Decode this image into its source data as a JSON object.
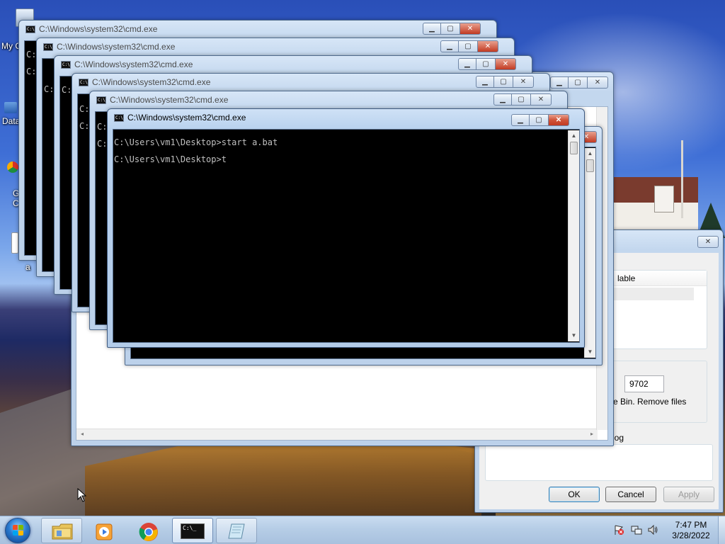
{
  "desktop": {
    "icons": [
      {
        "label": "My C"
      },
      {
        "label": "Data"
      },
      {
        "label": "G\nC"
      },
      {
        "label": "a"
      }
    ]
  },
  "windows": {
    "cmd_title": "C:\\Windows\\system32\\cmd.exe",
    "console_lines": [
      "C:\\Users\\vm1\\Desktop>start a.bat",
      "C:\\Users\\vm1\\Desktop>t"
    ],
    "peek_prompt": "C:",
    "minimize_glyph": "▁",
    "maximize_glyph": "▢",
    "close_glyph": "✕"
  },
  "dialog": {
    "list_header": "lable",
    "field_value": "9702",
    "recycle_text": "e Bin. Remove files",
    "log_text": "log",
    "ok_label": "OK",
    "cancel_label": "Cancel",
    "apply_label": "Apply"
  },
  "taskbar": {
    "start_label": "Start",
    "pinned": [
      {
        "name": "windows-explorer-button"
      },
      {
        "name": "media-player-button"
      },
      {
        "name": "chrome-button"
      },
      {
        "name": "cmd-button"
      },
      {
        "name": "notepad-button"
      }
    ],
    "clock_time": "7:47 PM",
    "clock_date": "3/28/2022"
  },
  "colors": {
    "titlebar": "#c3d7ee",
    "close_button": "#c23a22",
    "console_bg": "#000000",
    "console_text": "#c0c0c0",
    "taskbar": "#b6cde6"
  }
}
